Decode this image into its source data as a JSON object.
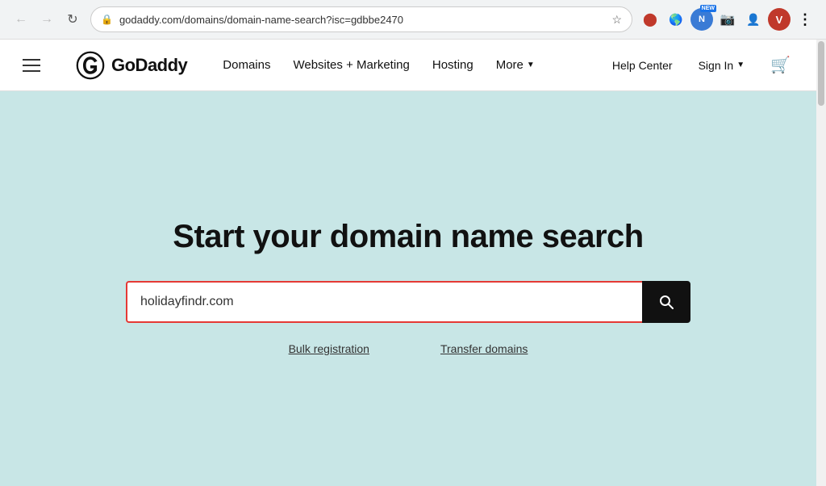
{
  "browser": {
    "url": "godaddy.com/domains/domain-name-search?isc=gdbbe2470",
    "back_btn": "←",
    "forward_btn": "→",
    "reload_btn": "↻",
    "star_label": "☆",
    "menu_btn": "⋮",
    "avatar_label": "V"
  },
  "header": {
    "logo_text": "GoDaddy",
    "nav_items": [
      {
        "label": "Domains",
        "has_dropdown": false
      },
      {
        "label": "Websites + Marketing",
        "has_dropdown": false
      },
      {
        "label": "Hosting",
        "has_dropdown": false
      },
      {
        "label": "More",
        "has_dropdown": true
      }
    ],
    "help_center": "Help Center",
    "sign_in": "Sign In",
    "cart_icon": "🛒"
  },
  "main": {
    "hero_title": "Start your domain name search",
    "search_placeholder": "holidayfindr.com",
    "search_input_value": "holidayfindr.com",
    "bulk_registration_label": "Bulk registration",
    "transfer_domains_label": "Transfer domains"
  }
}
